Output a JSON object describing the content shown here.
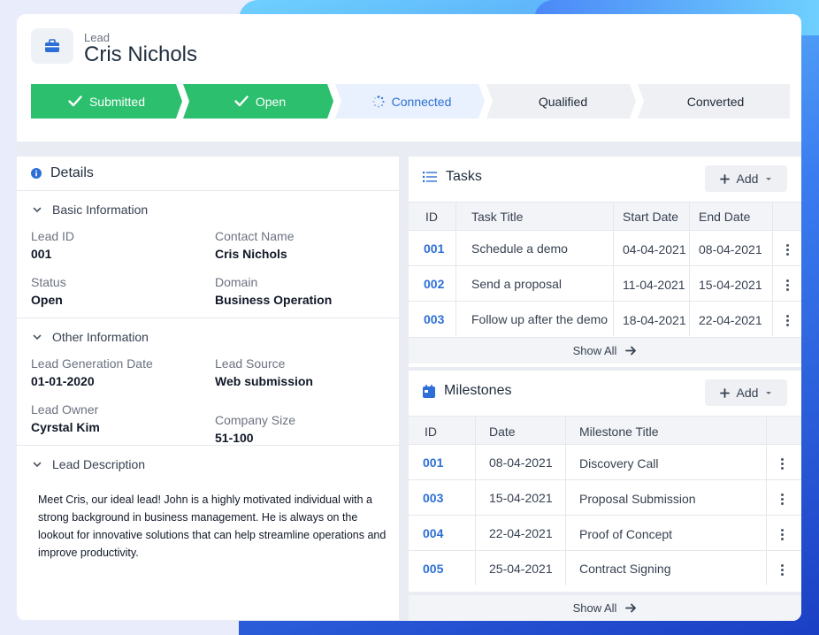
{
  "header": {
    "label": "Lead",
    "name": "Cris Nichols",
    "icon": "briefcase-icon"
  },
  "stages": [
    {
      "label": "Submitted",
      "status": "done"
    },
    {
      "label": "Open",
      "status": "done"
    },
    {
      "label": "Connected",
      "status": "active"
    },
    {
      "label": "Qualified",
      "status": "todo"
    },
    {
      "label": "Converted",
      "status": "todo"
    }
  ],
  "details": {
    "title": "Details",
    "basic": {
      "title": "Basic Information",
      "lead_id_label": "Lead ID",
      "lead_id": "001",
      "contact_label": "Contact Name",
      "contact": "Cris Nichols",
      "status_label": "Status",
      "status": "Open",
      "domain_label": "Domain",
      "domain": "Business Operation"
    },
    "other": {
      "title": "Other Information",
      "gen_date_label": "Lead Generation Date",
      "gen_date": "01-01-2020",
      "source_label": "Lead Source",
      "source": "Web submission",
      "owner_label": "Lead Owner",
      "owner": "Cyrstal Kim",
      "size_label": "Company Size",
      "size": "51-100"
    },
    "description": {
      "title": "Lead Description",
      "text": "Meet Cris, our ideal lead! John is a highly motivated individual with a strong background in business management. He is always on the lookout for innovative solutions that can help streamline operations and improve productivity."
    }
  },
  "tasks": {
    "title": "Tasks",
    "add_label": "Add",
    "columns": [
      "ID",
      "Task Title",
      "Start Date",
      "End Date"
    ],
    "rows": [
      [
        "001",
        "Schedule a demo",
        "04-04-2021",
        "08-04-2021"
      ],
      [
        "002",
        "Send a proposal",
        "11-04-2021",
        "15-04-2021"
      ],
      [
        "003",
        "Follow up after the demo",
        "18-04-2021",
        "22-04-2021"
      ]
    ],
    "show_all": "Show All"
  },
  "milestones": {
    "title": "Milestones",
    "add_label": "Add",
    "columns": [
      "ID",
      "Date",
      "Milestone Title"
    ],
    "rows": [
      [
        "001",
        "08-04-2021",
        "Discovery Call"
      ],
      [
        "003",
        "15-04-2021",
        "Proposal Submission"
      ],
      [
        "004",
        "22-04-2021",
        "Proof of Concept"
      ],
      [
        "005",
        "25-04-2021",
        "Contract Signing"
      ]
    ],
    "show_all": "Show All"
  },
  "colors": {
    "done": "#2cbf6e",
    "active_bg": "#e8f1fd",
    "active_text": "#2d6fd6",
    "accent": "#2d6fd6"
  }
}
